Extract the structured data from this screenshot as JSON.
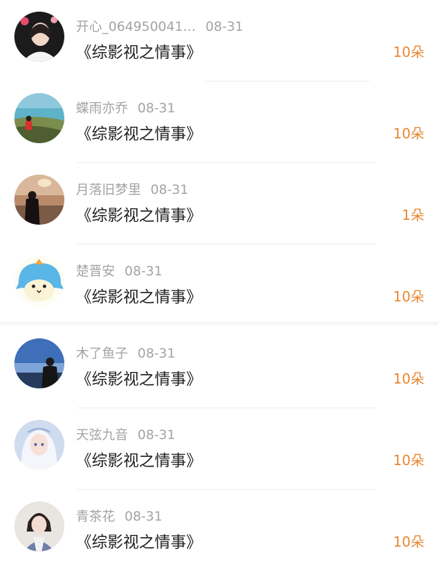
{
  "comments": [
    {
      "user": "开心_064950041…",
      "date": "08-31",
      "title": "《综影视之情事》",
      "gift": "10朵",
      "avatar": "avatar-girl-flowers"
    },
    {
      "user": "蝶雨亦乔",
      "date": "08-31",
      "title": "《综影视之情事》",
      "gift": "10朵",
      "avatar": "avatar-seaside"
    },
    {
      "user": "月落旧梦里",
      "date": "08-31",
      "title": "《综影视之情事》",
      "gift": "1朵",
      "avatar": "avatar-sunset-silhouette"
    },
    {
      "user": "楚晋安",
      "date": "08-31",
      "title": "《综影视之情事》",
      "gift": "10朵",
      "avatar": "avatar-blue-penguin"
    },
    {
      "user": "木了鱼子",
      "date": "08-31",
      "title": "《综影视之情事》",
      "gift": "10朵",
      "avatar": "avatar-blue-sky-person"
    },
    {
      "user": "天弦九音",
      "date": "08-31",
      "title": "《综影视之情事》",
      "gift": "10朵",
      "avatar": "avatar-anime-girl-white-hair"
    },
    {
      "user": "青茶花",
      "date": "08-31",
      "title": "《综影视之情事》",
      "gift": "10朵",
      "avatar": "avatar-illustrated-girl"
    }
  ]
}
